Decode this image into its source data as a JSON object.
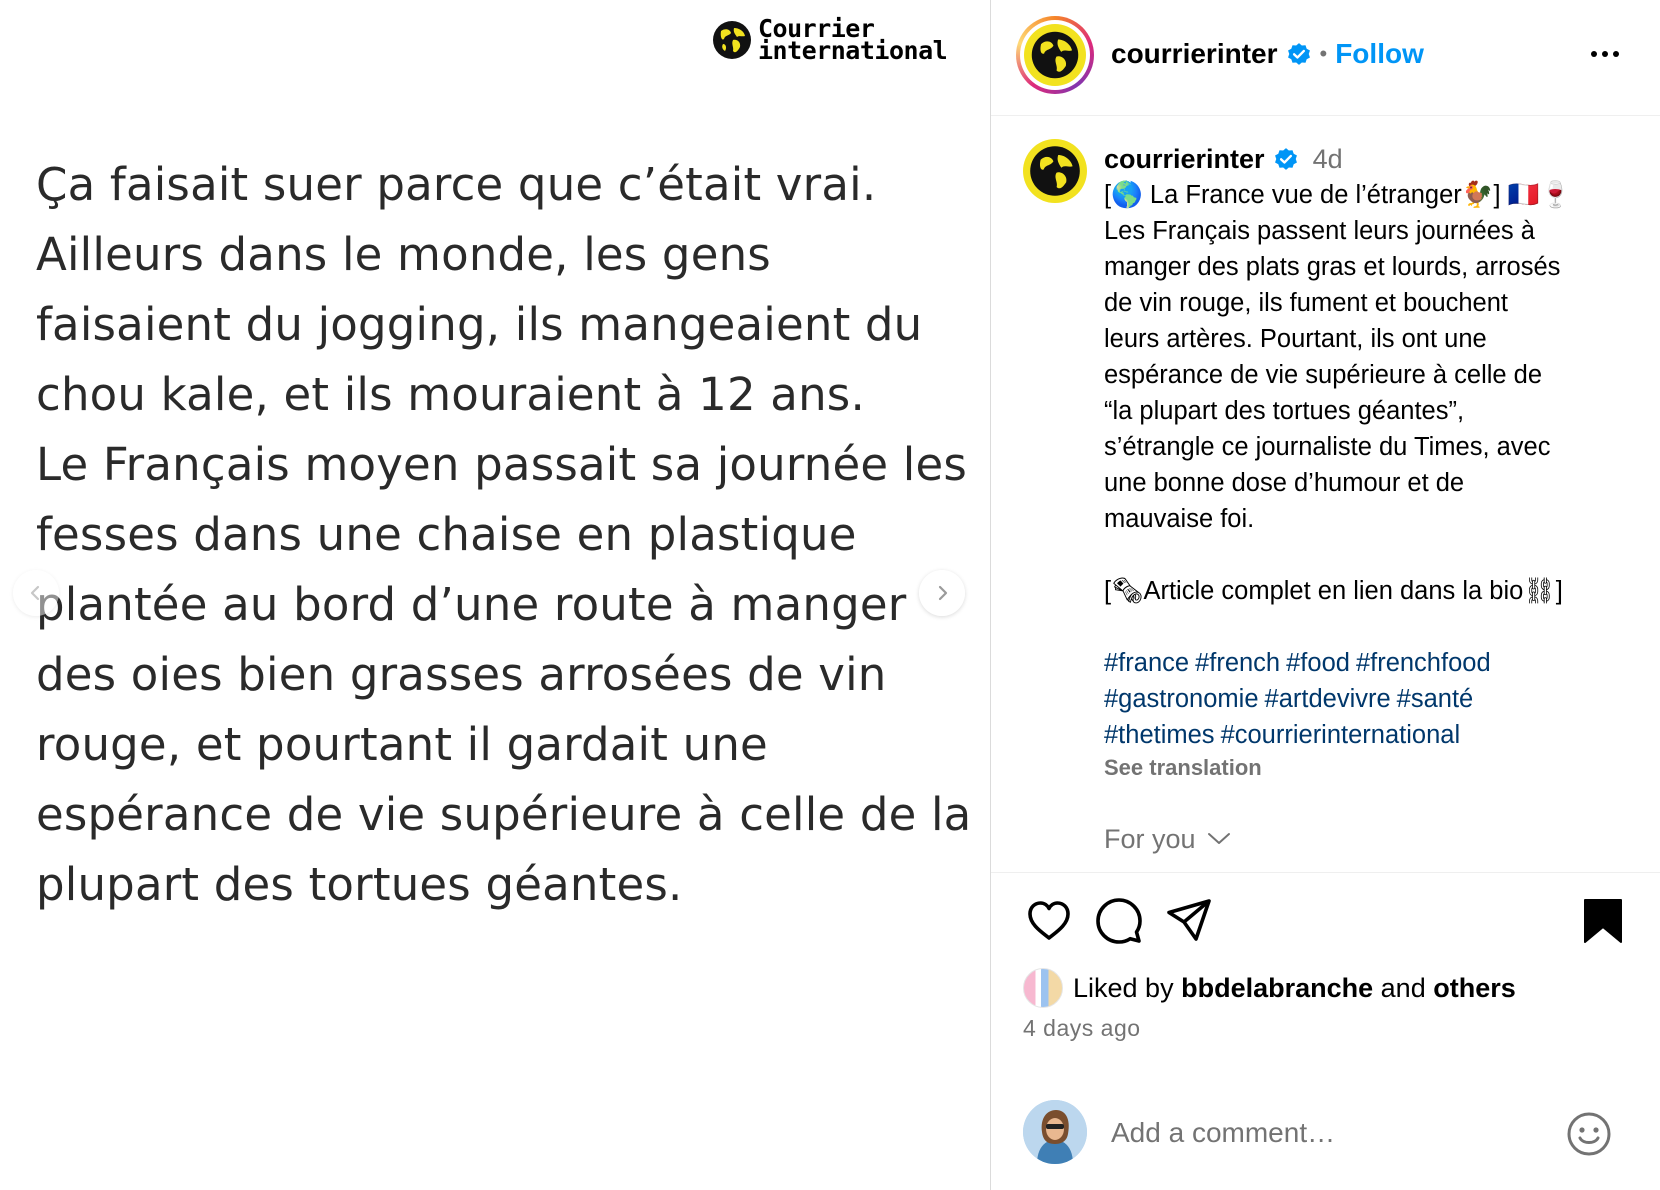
{
  "post_image": {
    "brand_line1": "Courrier",
    "brand_line2": "international",
    "quote_lines": [
      "Ça faisait suer parce que c’était vrai.",
      "Ailleurs dans le monde, les gens",
      "faisaient du jogging, ils mangeaient du",
      "chou kale, et ils mouraient à 12 ans.",
      "Le Français moyen passait sa journée les",
      "fesses dans une chaise en plastique",
      "plantée au bord d’une route à manger",
      "des oies bien grasses arrosées de vin",
      "rouge, et pourtant il gardait une",
      "espérance de vie supérieure à celle de la",
      "plupart des tortues géantes."
    ]
  },
  "header": {
    "username": "courrierinter",
    "separator": "•",
    "follow_label": "Follow"
  },
  "caption": {
    "username": "courrierinter",
    "time": "4d",
    "lines": [
      "[🌎 La France vue de l’étranger🐓] 🇫🇷🍷",
      "Les Français passent leurs journées à",
      "manger des plats gras et lourds, arrosés",
      "de vin rouge, ils fument et bouchent",
      "leurs artères. Pourtant, ils ont une",
      "espérance de vie supérieure à celle de",
      "“la plupart des tortues géantes”,",
      "s’étrangle ce journaliste du Times, avec",
      "une bonne dose d’humour et de",
      "mauvaise foi."
    ],
    "article_line": "[🗞Article complet en lien dans la bio⛓]",
    "hashtag_lines": [
      [
        "#france",
        "#french",
        "#food",
        "#frenchfood"
      ],
      [
        "#gastronomie",
        "#artdevivre",
        "#santé"
      ],
      [
        "#thetimes",
        "#courrierinternational"
      ]
    ],
    "see_translation": "See translation",
    "for_you": "For you"
  },
  "actions": {
    "liked_by_prefix": "Liked by",
    "liked_by_user": "bbdelabranche",
    "liked_by_and": "and",
    "liked_by_others": "others",
    "time_ago": "4 days ago"
  },
  "comment": {
    "placeholder": "Add a comment…"
  },
  "colors": {
    "link_blue": "#0095f6",
    "hashtag_blue": "#00376b",
    "muted_gray": "#737373",
    "logo_yellow": "#f2e21f"
  },
  "icons": [
    "globe-logo",
    "verified-badge-icon",
    "more-options-icon",
    "heart-icon",
    "comment-icon",
    "share-icon",
    "bookmark-icon",
    "chevron-down-icon",
    "emoji-icon",
    "chevron-left-icon",
    "chevron-right-icon"
  ]
}
